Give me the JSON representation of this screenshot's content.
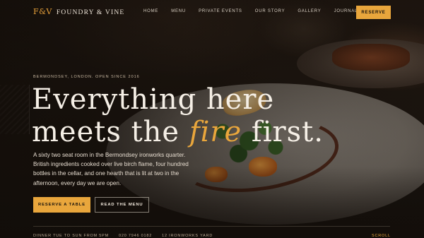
{
  "brand": {
    "mark": "F&V",
    "name": "FOUNDRY & VINE"
  },
  "nav": {
    "items": [
      "HOME",
      "MENU",
      "PRIVATE EVENTS",
      "OUR STORY",
      "GALLERY",
      "JOURNAL"
    ],
    "cta": "RESERVE"
  },
  "hero": {
    "eyebrow": "BERMONDSEY, LONDON. OPEN SINCE 2016",
    "headline_line1": "Everything here",
    "headline_line2_pre": "meets the ",
    "headline_accent": "fire",
    "headline_line2_post": " first.",
    "lede": "A sixty two seat room in the Bermondsey ironworks quarter. British ingredients cooked over live birch flame, four hundred bottles in the cellar, and one hearth that is lit at two in the afternoon, every day we are open.",
    "primary_button": "RESERVE A TABLE",
    "secondary_button": "READ THE MENU"
  },
  "footer": {
    "hours": "DINNER TUE TO SUN FROM 5PM",
    "phone": "020 7946 0182",
    "address": "12 IRONWORKS YARD",
    "scroll": "SCROLL"
  },
  "colors": {
    "accent": "#e9a63c",
    "background": "#14100c",
    "text": "#f5efe6"
  }
}
